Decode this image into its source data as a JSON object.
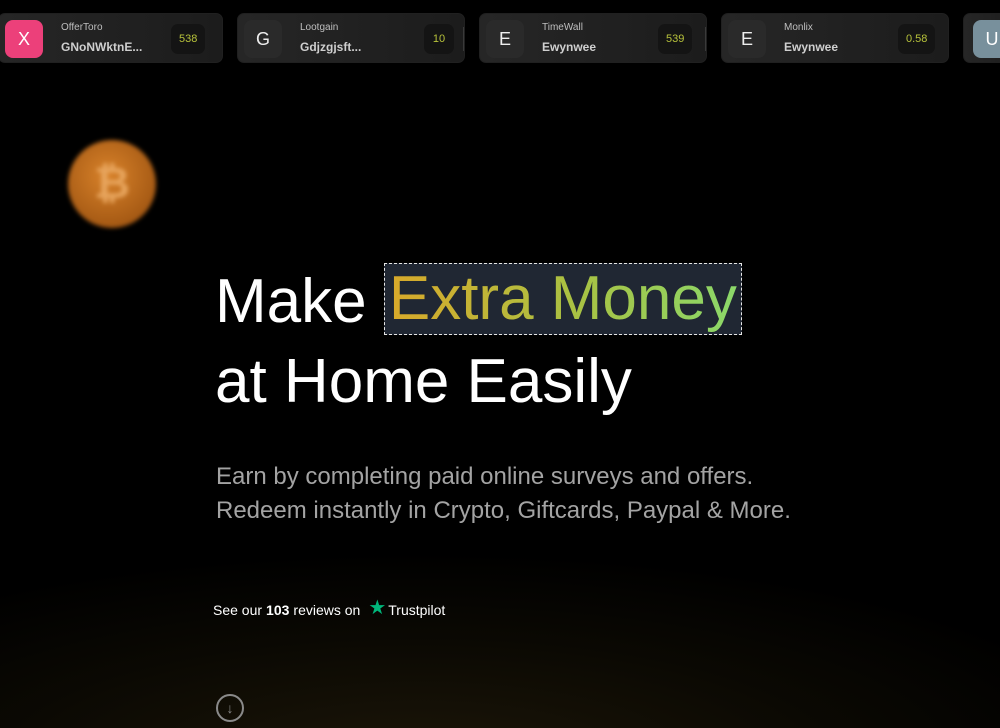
{
  "ticker": [
    {
      "avatar": "X",
      "name": "OfferToro",
      "user": "GNoNWktnE...",
      "amount": "538",
      "avatar_bg": "#ec407a"
    },
    {
      "avatar": "G",
      "name": "Lootgain",
      "user": "Gdjzgjsft...",
      "amount": "10",
      "avatar_bg": "#2a2a2a"
    },
    {
      "avatar": "E",
      "name": "TimeWall",
      "user": "Ewynwee",
      "amount": "539",
      "avatar_bg": "#2a2a2a"
    },
    {
      "avatar": "E",
      "name": "Monlix",
      "user": "Ewynwee",
      "amount": "0.58",
      "avatar_bg": "#2a2a2a"
    },
    {
      "avatar": "U",
      "name": "",
      "user": "",
      "amount": "",
      "avatar_bg": "#78909c"
    }
  ],
  "coin": {
    "symbol": "₿",
    "icon": "bitcoin-icon"
  },
  "hero": {
    "title_prefix": "Make",
    "title_highlight": "Extra Money",
    "title_line2": "at Home Easily",
    "subtitle_line1": "Earn by completing paid online surveys and offers.",
    "subtitle_line2": "Redeem instantly in Crypto, Giftcards, Paypal & More."
  },
  "reviews": {
    "prefix": "See our",
    "count": "103",
    "suffix": "reviews on",
    "brand": "Trustpilot",
    "star": "★"
  },
  "scroll": {
    "glyph": "↓",
    "icon": "arrow-down-icon"
  },
  "colors": {
    "amount": "#b7c23b",
    "trustpilot_green": "#00b67a",
    "subtitle": "#a3a3a3"
  }
}
